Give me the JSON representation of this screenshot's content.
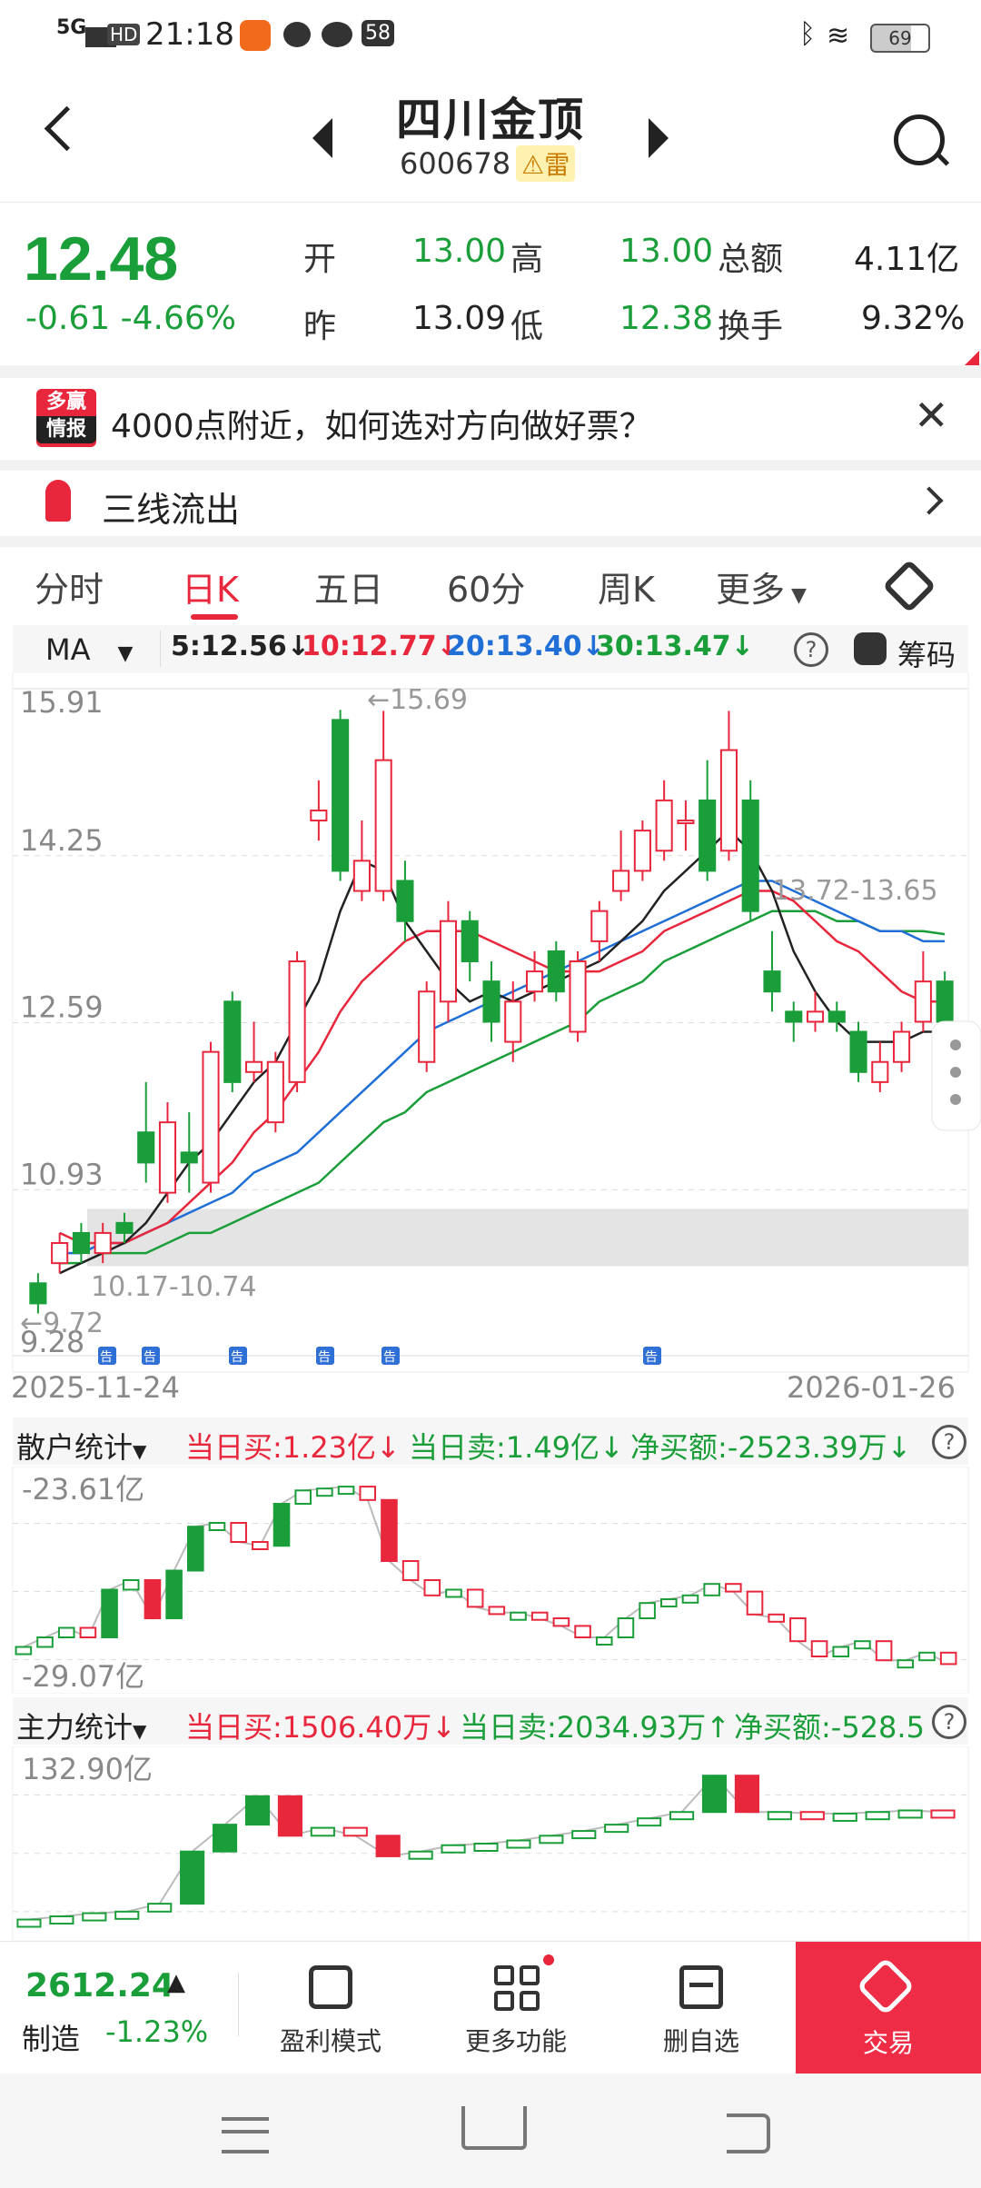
{
  "status_bar": {
    "network": "5G",
    "hd": "HD",
    "time": "21:18",
    "battery": "69",
    "app_badge": "58"
  },
  "header": {
    "title": "四川金顶",
    "code": "600678",
    "tag": "雷"
  },
  "quote": {
    "price": "12.48",
    "change": "-0.61",
    "change_pct": "-4.66%",
    "open_label": "开",
    "open": "13.00",
    "high_label": "高",
    "high": "13.00",
    "amount_label": "总额",
    "amount": "4.11亿",
    "prev_label": "昨",
    "prev": "13.09",
    "low_label": "低",
    "low": "12.38",
    "turnover_label": "换手",
    "turnover": "9.32%"
  },
  "banner": {
    "logo_top": "多赢",
    "logo_bottom": "情报",
    "text": "4000点附近，如何选对方向做好票？"
  },
  "signal": {
    "text": "三线流出"
  },
  "tabs": [
    {
      "label": "分时"
    },
    {
      "label": "日K"
    },
    {
      "label": "五日"
    },
    {
      "label": "60分"
    },
    {
      "label": "周K"
    },
    {
      "label": "更多"
    }
  ],
  "ma_bar": {
    "selector": "MA",
    "ma5": "5:12.56↓",
    "ma10": "10:12.77↓",
    "ma20": "20:13.40↓",
    "ma30": "30:13.47↓",
    "chip_label": "筹码"
  },
  "colors": {
    "up": "#e8263c",
    "down": "#1a9e3a",
    "ma5": "#222222",
    "ma10": "#e8263c",
    "ma20": "#1f6fd6",
    "ma30": "#1a9e3a"
  },
  "chart_data": {
    "type": "candlestick",
    "y_ticks": [
      "15.91",
      "14.25",
      "12.59",
      "10.93",
      "9.28"
    ],
    "ylim": [
      9.28,
      15.91
    ],
    "x_start": "2025-11-24",
    "x_end": "2026-01-26",
    "annotations": {
      "high": "←15.69",
      "low": "←9.72",
      "range_a": "10.17-10.74",
      "range_b": "13.72-13.65"
    },
    "event_markers": [
      "告",
      "告",
      "告",
      "告",
      "告",
      "告"
    ],
    "candles": [
      {
        "o": 10.0,
        "c": 9.8,
        "h": 10.1,
        "l": 9.7
      },
      {
        "o": 10.2,
        "c": 10.4,
        "h": 10.5,
        "l": 10.1
      },
      {
        "o": 10.5,
        "c": 10.3,
        "h": 10.6,
        "l": 10.2
      },
      {
        "o": 10.3,
        "c": 10.5,
        "h": 10.6,
        "l": 10.2
      },
      {
        "o": 10.6,
        "c": 10.5,
        "h": 10.7,
        "l": 10.4
      },
      {
        "o": 11.5,
        "c": 11.2,
        "h": 12.0,
        "l": 11.0
      },
      {
        "o": 10.9,
        "c": 11.6,
        "h": 11.8,
        "l": 10.8
      },
      {
        "o": 11.3,
        "c": 11.2,
        "h": 11.7,
        "l": 10.9
      },
      {
        "o": 11.0,
        "c": 12.3,
        "h": 12.4,
        "l": 10.9
      },
      {
        "o": 12.8,
        "c": 12.0,
        "h": 12.9,
        "l": 11.9
      },
      {
        "o": 12.1,
        "c": 12.2,
        "h": 12.6,
        "l": 12.0
      },
      {
        "o": 11.6,
        "c": 12.2,
        "h": 12.3,
        "l": 11.5
      },
      {
        "o": 12.0,
        "c": 13.2,
        "h": 13.3,
        "l": 11.9
      },
      {
        "o": 14.6,
        "c": 14.7,
        "h": 15.0,
        "l": 14.4
      },
      {
        "o": 15.6,
        "c": 14.1,
        "h": 15.7,
        "l": 14.0
      },
      {
        "o": 13.9,
        "c": 14.2,
        "h": 14.6,
        "l": 13.8
      },
      {
        "o": 13.9,
        "c": 15.2,
        "h": 15.69,
        "l": 13.8
      },
      {
        "o": 14.0,
        "c": 13.6,
        "h": 14.2,
        "l": 13.4
      },
      {
        "o": 12.2,
        "c": 12.9,
        "h": 13.0,
        "l": 12.1
      },
      {
        "o": 12.8,
        "c": 13.6,
        "h": 13.8,
        "l": 12.6
      },
      {
        "o": 13.6,
        "c": 13.2,
        "h": 13.7,
        "l": 13.0
      },
      {
        "o": 13.0,
        "c": 12.6,
        "h": 13.2,
        "l": 12.4
      },
      {
        "o": 12.4,
        "c": 12.8,
        "h": 13.0,
        "l": 12.2
      },
      {
        "o": 12.9,
        "c": 13.1,
        "h": 13.3,
        "l": 12.8
      },
      {
        "o": 13.3,
        "c": 12.9,
        "h": 13.4,
        "l": 12.8
      },
      {
        "o": 12.5,
        "c": 13.2,
        "h": 13.3,
        "l": 12.4
      },
      {
        "o": 13.4,
        "c": 13.7,
        "h": 13.8,
        "l": 13.2
      },
      {
        "o": 13.9,
        "c": 14.1,
        "h": 14.5,
        "l": 13.8
      },
      {
        "o": 14.1,
        "c": 14.5,
        "h": 14.6,
        "l": 14.0
      },
      {
        "o": 14.3,
        "c": 14.8,
        "h": 15.0,
        "l": 14.2
      },
      {
        "o": 14.6,
        "c": 14.6,
        "h": 14.8,
        "l": 14.3
      },
      {
        "o": 14.8,
        "c": 14.1,
        "h": 15.2,
        "l": 14.0
      },
      {
        "o": 14.3,
        "c": 15.3,
        "h": 15.69,
        "l": 14.2
      },
      {
        "o": 14.8,
        "c": 13.7,
        "h": 15.0,
        "l": 13.6
      },
      {
        "o": 13.1,
        "c": 12.9,
        "h": 13.5,
        "l": 12.7
      },
      {
        "o": 12.7,
        "c": 12.6,
        "h": 12.8,
        "l": 12.4
      },
      {
        "o": 12.6,
        "c": 12.7,
        "h": 12.9,
        "l": 12.5
      },
      {
        "o": 12.7,
        "c": 12.6,
        "h": 12.8,
        "l": 12.5
      },
      {
        "o": 12.5,
        "c": 12.1,
        "h": 12.6,
        "l": 12.0
      },
      {
        "o": 12.0,
        "c": 12.2,
        "h": 12.4,
        "l": 11.9
      },
      {
        "o": 12.2,
        "c": 12.5,
        "h": 12.6,
        "l": 12.1
      },
      {
        "o": 12.6,
        "c": 13.0,
        "h": 13.3,
        "l": 12.5
      },
      {
        "o": 13.0,
        "c": 12.6,
        "h": 13.1,
        "l": 12.4
      }
    ],
    "ma5": [
      10.1,
      10.2,
      10.3,
      10.4,
      10.6,
      10.9,
      11.2,
      11.4,
      11.7,
      12.0,
      12.2,
      12.6,
      13.0,
      13.7,
      14.2,
      14.1,
      13.6,
      13.3,
      13.0,
      12.8,
      12.9,
      12.8,
      12.9,
      13.0,
      13.1,
      13.2,
      13.4,
      13.6,
      13.9,
      14.1,
      14.3,
      14.5,
      14.3,
      13.9,
      13.3,
      12.9,
      12.6,
      12.4,
      12.4,
      12.4,
      12.5,
      12.5
    ],
    "ma10": [
      10.5,
      10.4,
      10.4,
      10.4,
      10.5,
      10.6,
      10.8,
      11.0,
      11.2,
      11.5,
      11.7,
      12.0,
      12.3,
      12.7,
      13.0,
      13.2,
      13.4,
      13.5,
      13.5,
      13.5,
      13.4,
      13.3,
      13.2,
      13.1,
      13.1,
      13.1,
      13.2,
      13.3,
      13.5,
      13.6,
      13.7,
      13.8,
      13.9,
      13.9,
      13.8,
      13.6,
      13.4,
      13.3,
      13.1,
      12.9,
      12.8,
      12.8
    ],
    "ma20": [
      10.3,
      10.3,
      10.4,
      10.4,
      10.5,
      10.6,
      10.7,
      10.8,
      10.9,
      11.1,
      11.2,
      11.3,
      11.5,
      11.7,
      11.9,
      12.1,
      12.3,
      12.5,
      12.6,
      12.7,
      12.8,
      12.9,
      13.0,
      13.1,
      13.2,
      13.3,
      13.4,
      13.5,
      13.6,
      13.7,
      13.8,
      13.9,
      14.0,
      14.0,
      13.9,
      13.8,
      13.7,
      13.6,
      13.5,
      13.5,
      13.4,
      13.4
    ],
    "ma30": [
      10.2,
      10.2,
      10.3,
      10.3,
      10.3,
      10.4,
      10.5,
      10.5,
      10.6,
      10.7,
      10.8,
      10.9,
      11.0,
      11.2,
      11.4,
      11.6,
      11.7,
      11.9,
      12.0,
      12.1,
      12.2,
      12.3,
      12.4,
      12.5,
      12.6,
      12.8,
      12.9,
      13.0,
      13.2,
      13.3,
      13.4,
      13.5,
      13.6,
      13.7,
      13.7,
      13.7,
      13.6,
      13.6,
      13.5,
      13.5,
      13.5,
      13.47
    ]
  },
  "retail_panel": {
    "label": "散户统计",
    "buy": "当日买:1.23亿↓",
    "sell": "当日卖:1.49亿↓",
    "net": "净买额:-2523.39万↓",
    "top": "-23.61亿",
    "bottom": "-29.07亿",
    "values": [
      0.15,
      0.2,
      0.25,
      0.2,
      0.45,
      0.5,
      0.3,
      0.55,
      0.78,
      0.8,
      0.7,
      0.68,
      0.9,
      0.97,
      0.98,
      0.99,
      0.92,
      0.6,
      0.5,
      0.42,
      0.45,
      0.36,
      0.33,
      0.33,
      0.3,
      0.26,
      0.2,
      0.2,
      0.3,
      0.38,
      0.4,
      0.42,
      0.48,
      0.44,
      0.32,
      0.3,
      0.18,
      0.1,
      0.15,
      0.18,
      0.08,
      0.08,
      0.12,
      0.06
    ]
  },
  "main_panel": {
    "label": "主力统计",
    "buy": "当日买:1506.40万↓",
    "sell": "当日卖:2034.93万↑",
    "net": "净买额:-528.5",
    "top": "132.90亿",
    "values": [
      0.02,
      0.04,
      0.06,
      0.07,
      0.12,
      0.45,
      0.62,
      0.8,
      0.55,
      0.6,
      0.55,
      0.42,
      0.45,
      0.49,
      0.5,
      0.52,
      0.55,
      0.58,
      0.62,
      0.66,
      0.7,
      0.93,
      0.7,
      0.7,
      0.69,
      0.69,
      0.7,
      0.71,
      0.7
    ]
  },
  "bottom_bar": {
    "index_value": "2612.24",
    "index_arrow": "▲",
    "index_name": "制造",
    "index_change": "-1.23%",
    "items": [
      {
        "label": "盈利模式"
      },
      {
        "label": "更多功能"
      },
      {
        "label": "删自选"
      },
      {
        "label": "交易"
      }
    ]
  }
}
